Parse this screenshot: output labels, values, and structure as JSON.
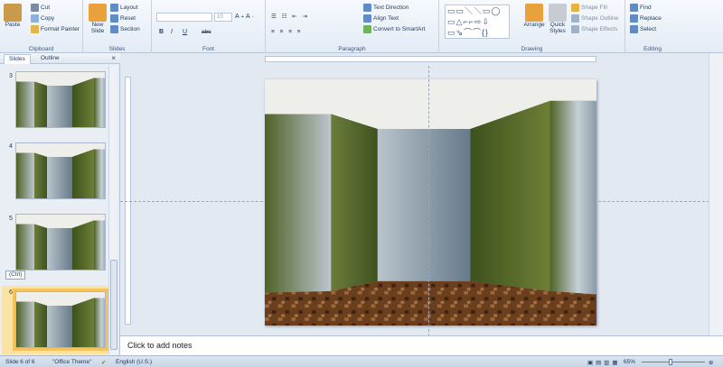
{
  "ribbon": {
    "clipboard": {
      "paste": "Paste",
      "cut": "Cut",
      "copy": "Copy",
      "format_painter": "Format Painter",
      "label": "Clipboard"
    },
    "slides": {
      "new_slide": "New Slide",
      "layout": "Layout",
      "reset": "Reset",
      "section": "Section",
      "label": "Slides"
    },
    "font": {
      "size_value": "10",
      "label": "Font",
      "bold": "B",
      "italic": "I",
      "underline": "U",
      "strike": "abc"
    },
    "paragraph": {
      "text_direction": "Text Direction",
      "align_text": "Align Text",
      "convert_smartart": "Convert to SmartArt",
      "label": "Paragraph"
    },
    "drawing": {
      "arrange": "Arrange",
      "quick_styles": "Quick Styles",
      "shape_fill": "Shape Fill",
      "shape_outline": "Shape Outline",
      "shape_effects": "Shape Effects",
      "label": "Drawing"
    },
    "editing": {
      "find": "Find",
      "replace": "Replace",
      "select": "Select",
      "label": "Editing"
    }
  },
  "pane": {
    "tabs": [
      "Slides",
      "Outline"
    ],
    "close": "×",
    "slide_numbers": [
      "3",
      "4",
      "5",
      "6"
    ],
    "ctrl_tag": "(Ctrl)"
  },
  "notes": {
    "placeholder": "Click to add notes"
  },
  "status": {
    "slide_info": "Slide 6 of 6",
    "theme": "\"Office Theme\"",
    "language": "English (U.S.)",
    "zoom": "65%"
  },
  "colors": {
    "accent": "#f6c25c",
    "wall_green": "#5a6b2c",
    "wall_gray": "#a4b0b8",
    "floor": "#6b3e1e"
  }
}
